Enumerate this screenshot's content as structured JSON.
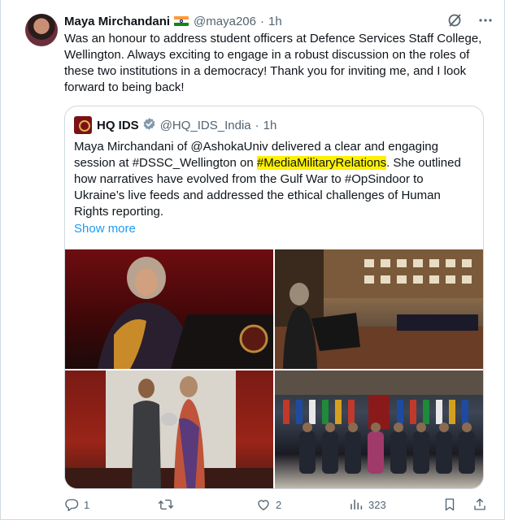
{
  "tweet": {
    "author_name": "Maya Mirchandani",
    "author_handle": "@maya206",
    "separator": "·",
    "time": "1h",
    "text": "Was an honour to address student officers at Defence Services Staff College, Wellington. Always exciting to engage in a robust discussion on the roles of these two institutions in a democracy! Thank you for inviting me, and I look forward to being back!"
  },
  "quote": {
    "author_name": "HQ IDS",
    "author_handle": "@HQ_IDS_India",
    "separator": "·",
    "time": "1h",
    "text_before": "Maya Mirchandani of @AshokaUniv delivered a clear and engaging session at #DSSC_Wellington on ",
    "highlighted_hashtag": "#MediaMilitaryRelations",
    "text_after": ". She outlined how narratives have evolved from the Gulf War to #OpSindoor to Ukraine’s live feeds and addressed the ethical challenges of Human Rights reporting.",
    "show_more": "Show more"
  },
  "actions": {
    "replies": "1",
    "reposts": "",
    "likes": "2",
    "views": "323"
  },
  "colors": {
    "accent": "#1d9bf0",
    "highlight": "#fff200",
    "muted": "#536471"
  }
}
